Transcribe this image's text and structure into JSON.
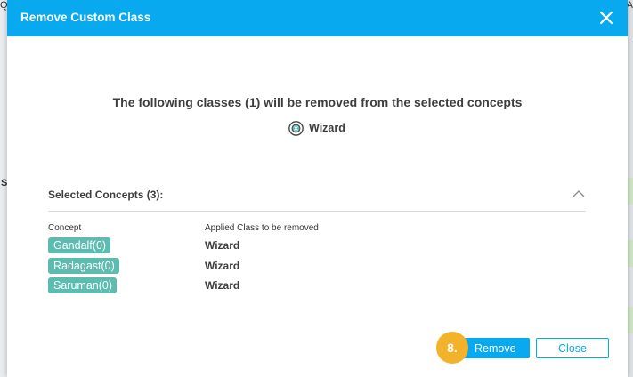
{
  "background": {
    "left_glyph": "Q",
    "left_letter": "S",
    "right_glyph": "A"
  },
  "dialog": {
    "title": "Remove Custom Class",
    "headline": "The following classes (1) will be removed from the selected concepts",
    "class_to_remove": "Wizard",
    "section_title": "Selected Concepts (3):",
    "columns": {
      "concept": "Concept",
      "applied_class": "Applied Class to be removed"
    },
    "rows": [
      {
        "concept": "Gandalf(0)",
        "applied_class": "Wizard"
      },
      {
        "concept": "Radagast(0)",
        "applied_class": "Wizard"
      },
      {
        "concept": "Saruman(0)",
        "applied_class": "Wizard"
      }
    ],
    "step_badge": "8.",
    "remove_label": "Remove",
    "close_label": "Close"
  },
  "colors": {
    "header": "#09a9f0",
    "concept_tag": "#5bbcaf",
    "step_badge": "#f2b22a"
  },
  "icons": {
    "close": "close-icon",
    "class": "class-icon",
    "collapse": "chevron-up-icon"
  }
}
